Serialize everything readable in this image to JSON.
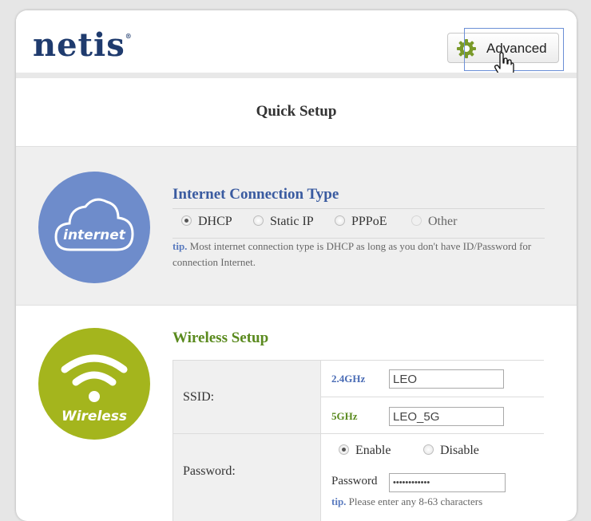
{
  "header": {
    "logo_text": "netis",
    "logo_mark": "®",
    "advanced_label": "Advanced",
    "advanced_icon": "gear-icon",
    "gear_color": "#7a9a2a"
  },
  "page": {
    "title": "Quick Setup"
  },
  "internet": {
    "icon_label": "internet",
    "heading": "Internet Connection Type",
    "options": [
      {
        "label": "DHCP",
        "checked": true,
        "disabled": false
      },
      {
        "label": "Static IP",
        "checked": false,
        "disabled": false
      },
      {
        "label": "PPPoE",
        "checked": false,
        "disabled": false
      },
      {
        "label": "Other",
        "checked": false,
        "disabled": true
      }
    ],
    "tip_prefix": "tip.",
    "tip_text": " Most internet connection type is DHCP as long as you don't have ID/Password for connection Internet.",
    "accent": "#6e8ccb"
  },
  "wireless": {
    "icon_label": "Wireless",
    "heading": "Wireless Setup",
    "ssid_label": "SSID:",
    "band_24_label": "2.4GHz",
    "ssid_24_value": "LEO",
    "band_5_label": "5GHz",
    "ssid_5_value": "LEO_5G",
    "password_label": "Password:",
    "enable_label": "Enable",
    "disable_label": "Disable",
    "enable_checked": true,
    "pw_field_label": "Password",
    "pw_value": "••••••••••••",
    "tip_prefix": "tip.",
    "tip_text": " Please enter any 8-63 characters",
    "accent": "#a4b51d"
  }
}
